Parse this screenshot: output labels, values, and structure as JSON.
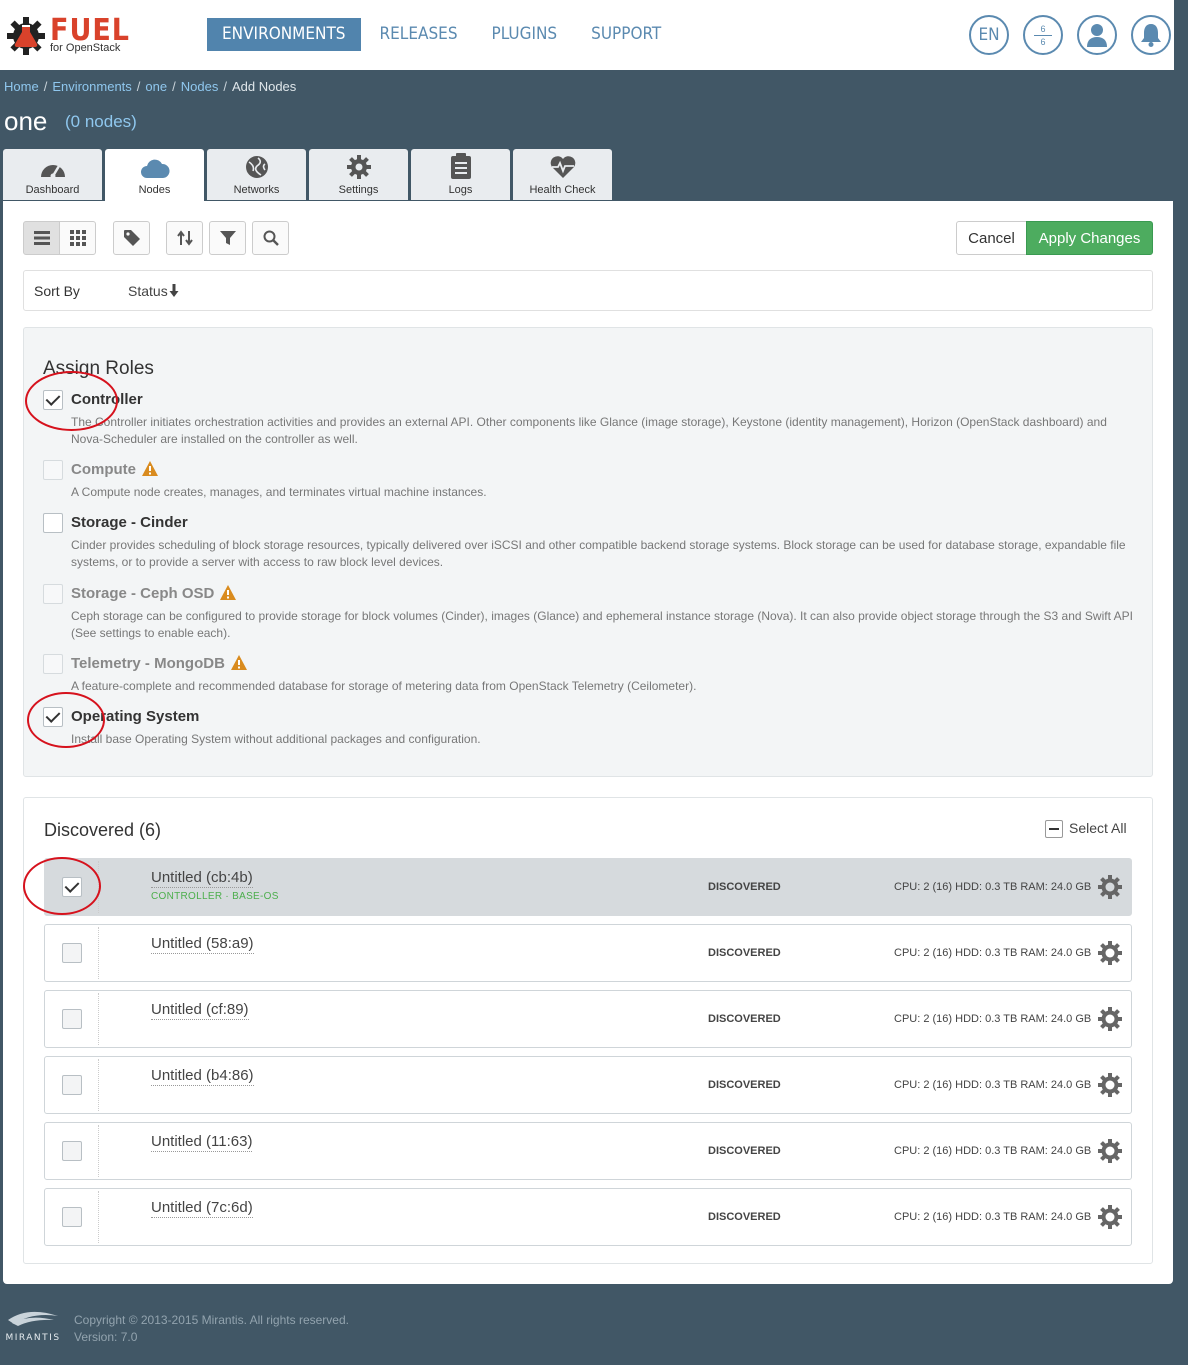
{
  "brand": {
    "name": "FUEL",
    "subtitle": "for OpenStack"
  },
  "nav": [
    {
      "label": "ENVIRONMENTS",
      "active": true
    },
    {
      "label": "RELEASES",
      "active": false
    },
    {
      "label": "PLUGINS",
      "active": false
    },
    {
      "label": "SUPPORT",
      "active": false
    }
  ],
  "header": {
    "language": "EN",
    "stats_top": "6",
    "stats_bottom": "6"
  },
  "breadcrumb": [
    {
      "label": "Home",
      "link": true
    },
    {
      "label": "Environments",
      "link": true
    },
    {
      "label": "one",
      "link": true
    },
    {
      "label": "Nodes",
      "link": true
    },
    {
      "label": "Add Nodes",
      "link": false
    }
  ],
  "environment": {
    "name": "one",
    "node_count": "(0 nodes)"
  },
  "tabs": [
    {
      "label": "Dashboard",
      "icon": "dashboard-icon",
      "active": false
    },
    {
      "label": "Nodes",
      "icon": "cloud-icon",
      "active": true
    },
    {
      "label": "Networks",
      "icon": "globe-icon",
      "active": false
    },
    {
      "label": "Settings",
      "icon": "gear-icon",
      "active": false
    },
    {
      "label": "Logs",
      "icon": "clipboard-icon",
      "active": false
    },
    {
      "label": "Health Check",
      "icon": "heart-pulse-icon",
      "active": false
    }
  ],
  "actions": {
    "cancel": "Cancel",
    "apply": "Apply Changes"
  },
  "sort": {
    "label": "Sort By",
    "value": "Status"
  },
  "roles": {
    "title": "Assign Roles",
    "items": [
      {
        "name": "Controller",
        "checked": true,
        "disabled": false,
        "warning": false,
        "description": "The Controller initiates orchestration activities and provides an external API. Other components like Glance (image storage), Keystone (identity management), Horizon (OpenStack dashboard) and Nova-Scheduler are installed on the controller as well."
      },
      {
        "name": "Compute",
        "checked": false,
        "disabled": true,
        "warning": true,
        "description": "A Compute node creates, manages, and terminates virtual machine instances."
      },
      {
        "name": "Storage - Cinder",
        "checked": false,
        "disabled": false,
        "warning": false,
        "description": "Cinder provides scheduling of block storage resources, typically delivered over iSCSI and other compatible backend storage systems. Block storage can be used for database storage, expandable file systems, or to provide a server with access to raw block level devices."
      },
      {
        "name": "Storage - Ceph OSD",
        "checked": false,
        "disabled": true,
        "warning": true,
        "description": "Ceph storage can be configured to provide storage for block volumes (Cinder), images (Glance) and ephemeral instance storage (Nova). It can also provide object storage through the S3 and Swift API (See settings to enable each)."
      },
      {
        "name": "Telemetry - MongoDB",
        "checked": false,
        "disabled": true,
        "warning": true,
        "description": "A feature-complete and recommended database for storage of metering data from OpenStack Telemetry (Ceilometer)."
      },
      {
        "name": "Operating System",
        "checked": true,
        "disabled": false,
        "warning": false,
        "description": "Install base Operating System without additional packages and configuration."
      }
    ]
  },
  "discovered": {
    "title": "Discovered (6)",
    "select_all": "Select All",
    "nodes": [
      {
        "name": "Untitled (cb:4b)",
        "roles": "CONTROLLER · BASE-OS",
        "status": "DISCOVERED",
        "specs": "CPU: 2 (16)  HDD: 0.3 TB  RAM: 24.0 GB",
        "checked": true
      },
      {
        "name": "Untitled (58:a9)",
        "roles": "",
        "status": "DISCOVERED",
        "specs": "CPU: 2 (16)  HDD: 0.3 TB  RAM: 24.0 GB",
        "checked": false
      },
      {
        "name": "Untitled (cf:89)",
        "roles": "",
        "status": "DISCOVERED",
        "specs": "CPU: 2 (16)  HDD: 0.3 TB  RAM: 24.0 GB",
        "checked": false
      },
      {
        "name": "Untitled (b4:86)",
        "roles": "",
        "status": "DISCOVERED",
        "specs": "CPU: 2 (16)  HDD: 0.3 TB  RAM: 24.0 GB",
        "checked": false
      },
      {
        "name": "Untitled (11:63)",
        "roles": "",
        "status": "DISCOVERED",
        "specs": "CPU: 2 (16)  HDD: 0.3 TB  RAM: 24.0 GB",
        "checked": false
      },
      {
        "name": "Untitled (7c:6d)",
        "roles": "",
        "status": "DISCOVERED",
        "specs": "CPU: 2 (16)  HDD: 0.3 TB  RAM: 24.0 GB",
        "checked": false
      }
    ]
  },
  "footer": {
    "brand": "MIRANTIS",
    "copyright": "Copyright © 2013-2015 Mirantis. All rights reserved.",
    "version": "Version: 7.0"
  },
  "colors": {
    "background": "#415766",
    "nav_active": "#5184ad",
    "apply": "#4dac5f",
    "brand_red": "#d9422b",
    "annotation_red": "#d6121d"
  }
}
